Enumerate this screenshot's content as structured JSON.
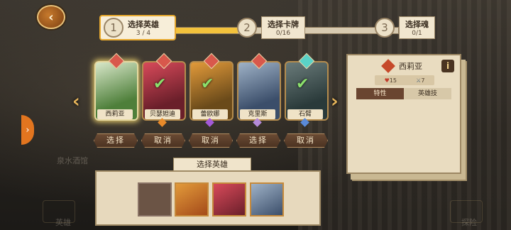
{
  "bg_text": {
    "tavern": "泉水酒馆",
    "explore": "探险",
    "hero": "英雄"
  },
  "back_icon": "‹",
  "side_tab_icon": "›",
  "steps": [
    {
      "num": "1",
      "title": "选择英雄",
      "count": "3 / 4",
      "active": true
    },
    {
      "num": "2",
      "title": "选择卡牌",
      "count": "0/16",
      "active": false
    },
    {
      "num": "3",
      "title": "选择魂",
      "count": "0/1",
      "active": false
    }
  ],
  "step_progress": 0.42,
  "heroes": [
    {
      "name": "西莉亚",
      "gem_color": "#d8584c",
      "star_color": "",
      "art": [
        "#4e7f3a",
        "#d8e7c9"
      ],
      "selected": true,
      "checked": false,
      "button": "选择"
    },
    {
      "name": "贝瑟妲迪",
      "gem_color": "#d8584c",
      "star_color": "#e98a2a",
      "art": [
        "#6a1f2a",
        "#d84a5a"
      ],
      "selected": false,
      "checked": true,
      "button": "取消"
    },
    {
      "name": "蕾欧娜",
      "gem_color": "#d8584c",
      "star_color": "#a45ad8",
      "art": [
        "#6a4a1a",
        "#e29a3a"
      ],
      "selected": false,
      "checked": true,
      "button": "取消"
    },
    {
      "name": "克里斯",
      "gem_color": "#d8584c",
      "star_color": "#b48ad8",
      "art": [
        "#3b4e6a",
        "#9fb2c7"
      ],
      "selected": false,
      "checked": false,
      "button": "选择"
    },
    {
      "name": "石臂",
      "gem_color": "#5ad2c7",
      "star_color": "#5a8ad8",
      "art": [
        "#2a3a3a",
        "#6a7b7a"
      ],
      "selected": false,
      "checked": true,
      "button": "取消"
    }
  ],
  "nav": {
    "prev": "‹",
    "next": "›"
  },
  "panel": {
    "hero_name": "西莉亚",
    "info_icon": "i",
    "hp": "15",
    "attack": "7",
    "tab_traits": "特性",
    "tab_skill": "英雄技"
  },
  "bottom": {
    "title": "选择英雄",
    "slots": [
      {
        "empty": true,
        "colors": [
          "#6b5445",
          "#6b5445"
        ]
      },
      {
        "empty": false,
        "colors": [
          "#e29a3a",
          "#a44a1a"
        ]
      },
      {
        "empty": false,
        "colors": [
          "#d84a5a",
          "#6a1f2a"
        ]
      },
      {
        "empty": false,
        "colors": [
          "#9fb2c7",
          "#3b4e6a"
        ]
      }
    ]
  }
}
